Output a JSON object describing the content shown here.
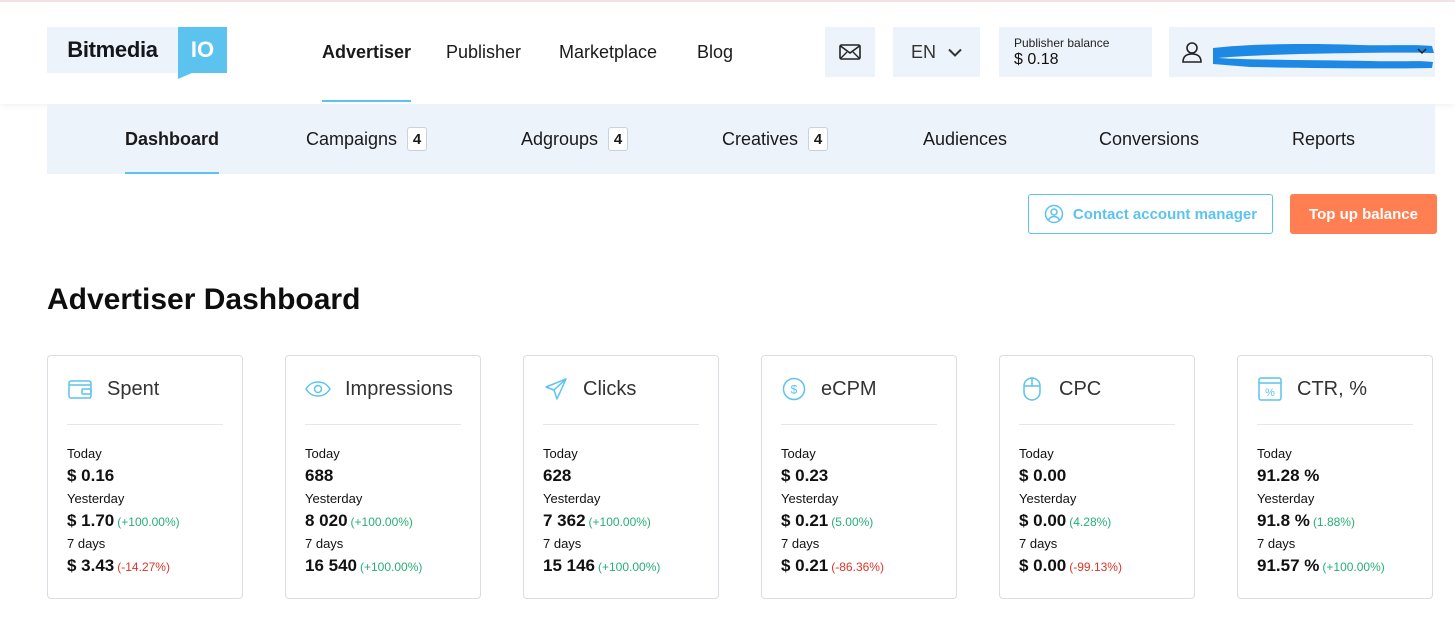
{
  "header": {
    "logo_left": "Bitmedia",
    "logo_right": "IO",
    "nav": [
      {
        "label": "Advertiser",
        "active": true
      },
      {
        "label": "Publisher",
        "active": false
      },
      {
        "label": "Marketplace",
        "active": false
      },
      {
        "label": "Blog",
        "active": false
      }
    ],
    "language": "EN",
    "balance_label": "Publisher balance",
    "balance_value": "$ 0.18"
  },
  "subnav": [
    {
      "label": "Dashboard",
      "badge": null,
      "active": true
    },
    {
      "label": "Campaigns",
      "badge": "4"
    },
    {
      "label": "Adgroups",
      "badge": "4"
    },
    {
      "label": "Creatives",
      "badge": "4"
    },
    {
      "label": "Audiences",
      "badge": null
    },
    {
      "label": "Conversions",
      "badge": null
    },
    {
      "label": "Reports",
      "badge": null
    }
  ],
  "actions": {
    "contact_label": "Contact account manager",
    "topup_label": "Top up balance"
  },
  "page_title": "Advertiser Dashboard",
  "period_labels": {
    "today": "Today",
    "yesterday": "Yesterday",
    "week": "7 days"
  },
  "colors": {
    "accent": "#5cc3ee",
    "cta": "#ff7f52",
    "positive": "#27ae7a",
    "negative": "#d9362b",
    "panel": "#edf3fa"
  },
  "cards": [
    {
      "title": "Spent",
      "icon": "wallet-icon",
      "today": "$ 0.16",
      "yesterday": "$ 1.70",
      "yesterday_delta": "(+100.00%)",
      "yesterday_dir": "pos",
      "week": "$ 3.43",
      "week_delta": "(-14.27%)",
      "week_dir": "neg"
    },
    {
      "title": "Impressions",
      "icon": "eye-icon",
      "today": "688",
      "yesterday": "8 020",
      "yesterday_delta": "(+100.00%)",
      "yesterday_dir": "pos",
      "week": "16 540",
      "week_delta": "(+100.00%)",
      "week_dir": "pos"
    },
    {
      "title": "Clicks",
      "icon": "send-icon",
      "today": "628",
      "yesterday": "7 362",
      "yesterday_delta": "(+100.00%)",
      "yesterday_dir": "pos",
      "week": "15 146",
      "week_delta": "(+100.00%)",
      "week_dir": "pos"
    },
    {
      "title": "eCPM",
      "icon": "dollar-circle-icon",
      "today": "$ 0.23",
      "yesterday": "$ 0.21",
      "yesterday_delta": "(5.00%)",
      "yesterday_dir": "pos",
      "week": "$ 0.21",
      "week_delta": "(-86.36%)",
      "week_dir": "neg"
    },
    {
      "title": "CPC",
      "icon": "mouse-icon",
      "today": "$ 0.00",
      "yesterday": "$ 0.00",
      "yesterday_delta": "(4.28%)",
      "yesterday_dir": "pos",
      "week": "$ 0.00",
      "week_delta": "(-99.13%)",
      "week_dir": "neg"
    },
    {
      "title": "CTR, %",
      "icon": "percent-icon",
      "today": "91.28 %",
      "yesterday": "91.8 %",
      "yesterday_delta": "(1.88%)",
      "yesterday_dir": "pos",
      "week": "91.57 %",
      "week_delta": "(+100.00%)",
      "week_dir": "pos"
    }
  ]
}
